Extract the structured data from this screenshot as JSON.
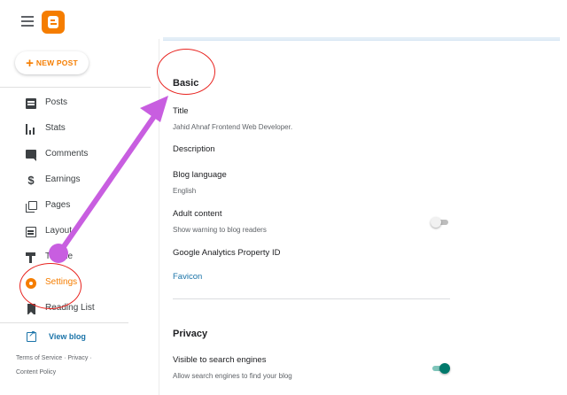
{
  "header": {
    "menu_icon": "hamburger-menu-icon",
    "logo_icon": "blogger-logo-icon",
    "brand_color": "#f57d00"
  },
  "sidebar": {
    "new_post_label": "NEW POST",
    "items": [
      {
        "label": "Posts",
        "icon": "posts-icon"
      },
      {
        "label": "Stats",
        "icon": "stats-icon"
      },
      {
        "label": "Comments",
        "icon": "comments-icon"
      },
      {
        "label": "Earnings",
        "icon": "dollar-icon"
      },
      {
        "label": "Pages",
        "icon": "pages-icon"
      },
      {
        "label": "Layout",
        "icon": "layout-icon"
      },
      {
        "label": "Theme",
        "icon": "theme-icon"
      },
      {
        "label": "Settings",
        "icon": "gear-icon",
        "active": true
      },
      {
        "label": "Reading List",
        "icon": "bookmark-icon"
      }
    ],
    "view_blog_label": "View blog",
    "footer": {
      "terms": "Terms of Service",
      "sep1": "·",
      "privacy": "Privacy",
      "sep2": "·",
      "content_policy": "Content Policy"
    }
  },
  "main": {
    "basic": {
      "title": "Basic",
      "title_field_label": "Title",
      "title_field_value": "Jahid Ahnaf Frontend Web Developer.",
      "description_label": "Description",
      "language_label": "Blog language",
      "language_value": "English",
      "adult_label": "Adult content",
      "adult_desc": "Show warning to blog readers",
      "adult_enabled": false,
      "analytics_label": "Google Analytics Property ID",
      "favicon_label": "Favicon"
    },
    "privacy": {
      "title": "Privacy",
      "visible_label": "Visible to search engines",
      "visible_desc": "Allow search engines to find your blog",
      "visible_enabled": true
    }
  },
  "colors": {
    "active": "#f57d00",
    "link": "#1a73a8",
    "toggle_on": "#00796b",
    "annotation_circle": "#e8231f",
    "annotation_arrow": "#c85ee0"
  }
}
